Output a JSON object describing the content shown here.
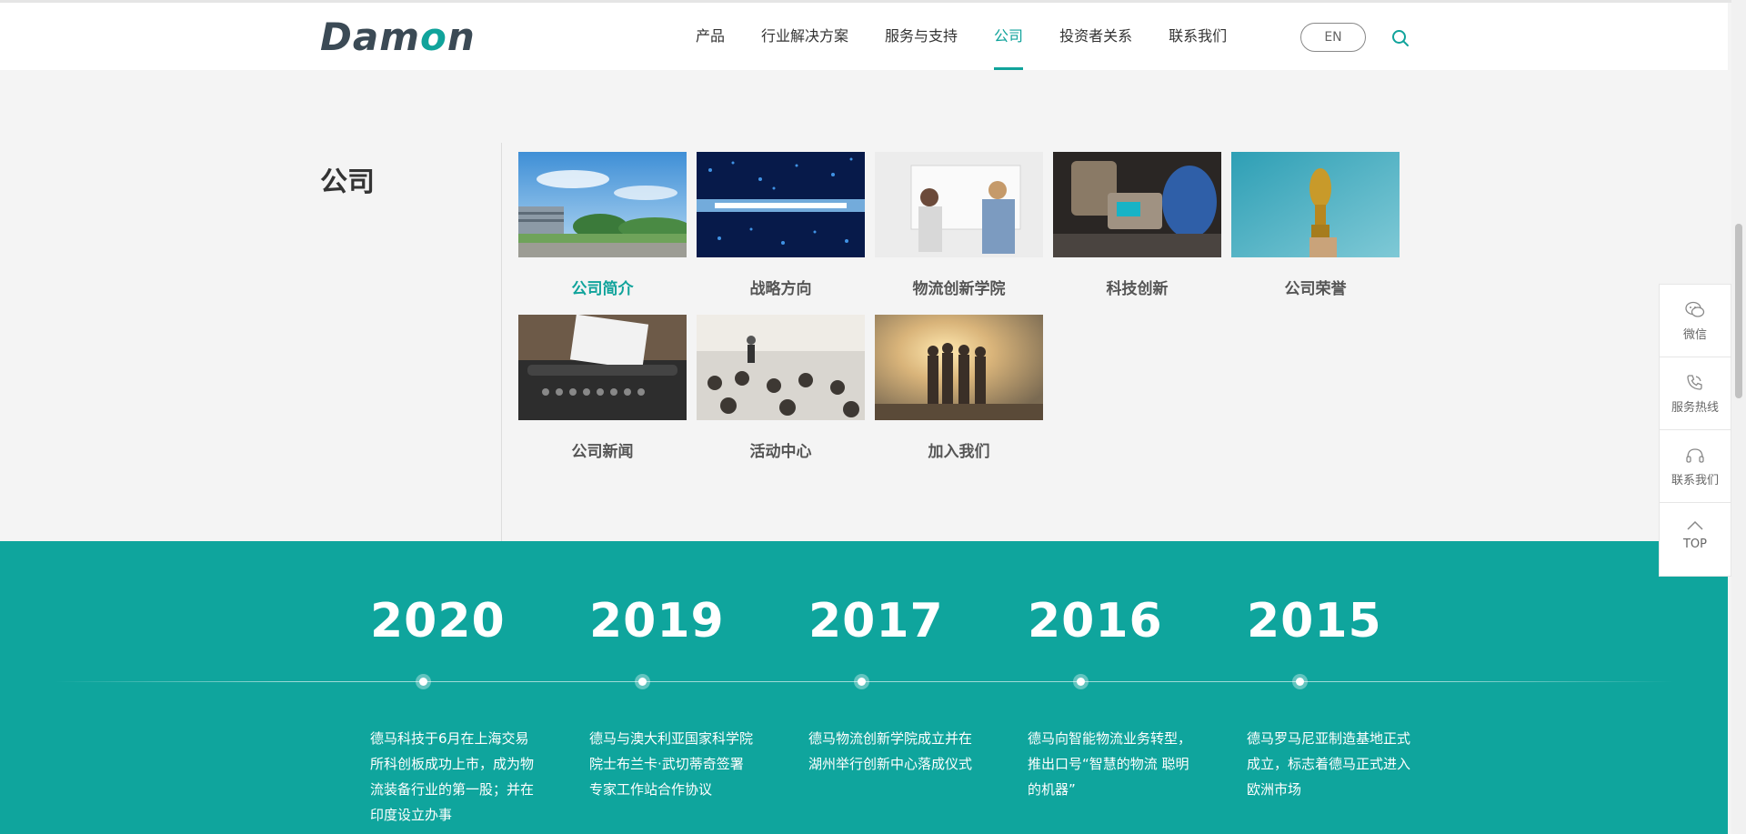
{
  "brand": {
    "logo_text": "Damon",
    "accent": "#10a39b"
  },
  "nav": {
    "items": [
      "产品",
      "行业解决方案",
      "服务与支持",
      "公司",
      "投资者关系",
      "联系我们"
    ],
    "active": "公司",
    "lang_button": "EN"
  },
  "section": {
    "title": "公司"
  },
  "cards": [
    {
      "label": "公司简介",
      "active": true
    },
    {
      "label": "战略方向"
    },
    {
      "label": "物流创新学院"
    },
    {
      "label": "科技创新"
    },
    {
      "label": "公司荣誉"
    },
    {
      "label": "公司新闻"
    },
    {
      "label": "活动中心"
    },
    {
      "label": "加入我们"
    }
  ],
  "timeline": [
    {
      "year": "2020",
      "text": " 德马科技于6月在上海交易所科创板成功上市，成为物流装备行业的第一股；并在印度设立办事"
    },
    {
      "year": "2019",
      "text": "德马与澳大利亚国家科学院院士布兰卡·武切蒂奇签署专家工作站合作协议"
    },
    {
      "year": "2017",
      "text": "德马物流创新学院成立并在湖州举行创新中心落成仪式"
    },
    {
      "year": "2016",
      "text": "德马向智能物流业务转型，推出口号“智慧的物流 聪明的机器”"
    },
    {
      "year": "2015",
      "text": "德马罗马尼亚制造基地正式成立，标志着德马正式进入欧洲市场"
    }
  ],
  "side_tools": {
    "wechat": "微信",
    "hotline": "服务热线",
    "contact": "联系我们",
    "top": "TOP"
  }
}
